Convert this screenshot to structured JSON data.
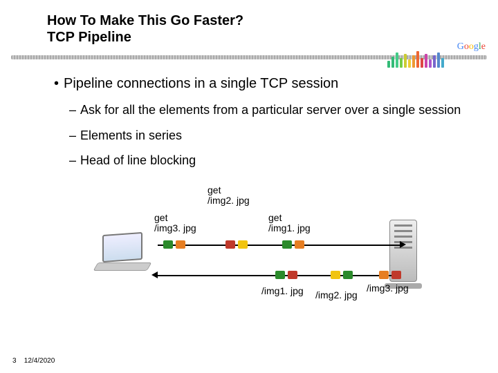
{
  "title_line1": "How To Make This Go Faster?",
  "title_line2": "TCP Pipeline",
  "logo": {
    "g1": "G",
    "g2": "o",
    "g3": "o",
    "g4": "g",
    "g5": "l",
    "g6": "e"
  },
  "bullet_main": "Pipeline connections in a single TCP session",
  "sub": [
    "Ask for all the elements from a particular server over a single session",
    "Elements in series",
    "Head of line blocking"
  ],
  "labels": {
    "req3_a": "get",
    "req3_b": "/img3. jpg",
    "req2_a": "get",
    "req2_b": "/img2. jpg",
    "req1_a": "get",
    "req1_b": "/img1. jpg",
    "resp1": "/img1. jpg",
    "resp2": "/img2. jpg",
    "resp3": "/img3. jpg"
  },
  "footer": {
    "page": "3",
    "date": "12/4/2020"
  }
}
